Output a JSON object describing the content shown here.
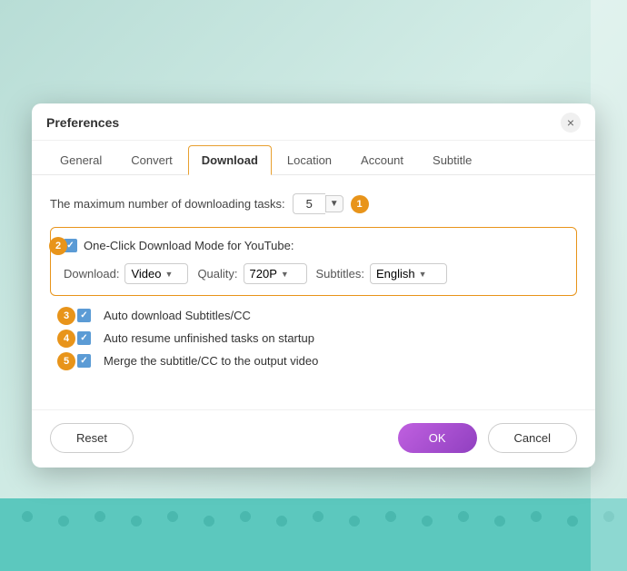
{
  "dialog": {
    "title": "Preferences",
    "close_icon": "×"
  },
  "tabs": {
    "items": [
      {
        "id": "general",
        "label": "General",
        "active": false
      },
      {
        "id": "convert",
        "label": "Convert",
        "active": false
      },
      {
        "id": "download",
        "label": "Download",
        "active": true
      },
      {
        "id": "location",
        "label": "Location",
        "active": false
      },
      {
        "id": "account",
        "label": "Account",
        "active": false
      },
      {
        "id": "subtitle",
        "label": "Subtitle",
        "active": false
      }
    ]
  },
  "settings": {
    "max_tasks_label": "The maximum number of downloading tasks:",
    "max_tasks_value": "5",
    "step1_badge": "1",
    "one_click_label": "One-Click Download Mode for YouTube:",
    "step2_badge": "2",
    "download_label": "Download:",
    "download_value": "Video",
    "quality_label": "Quality:",
    "quality_value": "720P",
    "subtitles_label": "Subtitles:",
    "subtitles_value": "English",
    "option3_label": "Auto download Subtitles/CC",
    "step3_badge": "3",
    "option4_label": "Auto resume unfinished tasks on startup",
    "step4_badge": "4",
    "option5_label": "Merge the subtitle/CC to the output video",
    "step5_badge": "5"
  },
  "footer": {
    "reset_label": "Reset",
    "ok_label": "OK",
    "cancel_label": "Cancel"
  }
}
